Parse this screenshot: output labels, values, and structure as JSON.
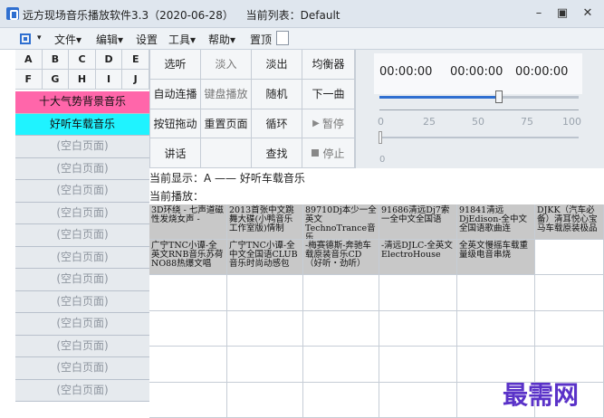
{
  "window": {
    "title": "远方现场音乐播放软件3.3（2020-06-28）",
    "current_list_label": "当前列表：Default",
    "minimize_glyph": "–",
    "maximize_glyph": "▣",
    "close_glyph": "✕"
  },
  "menubar": {
    "items": [
      "文件▾",
      "编辑▾",
      "设置",
      "工具▾",
      "帮助▾",
      "置顶"
    ]
  },
  "letters": [
    "A",
    "B",
    "C",
    "D",
    "E",
    "F",
    "G",
    "H",
    "I",
    "J"
  ],
  "pages": [
    "十大气势背景音乐",
    "好听车载音乐",
    "(空白页面)",
    "(空白页面)",
    "(空白页面)",
    "(空白页面)",
    "(空白页面)",
    "(空白页面)",
    "(空白页面)",
    "(空白页面)",
    "(空白页面)",
    "(空白页面)",
    "(空白页面)",
    "(空白页面)"
  ],
  "function_buttons": [
    "选听",
    "淡入",
    "淡出",
    "均衡器",
    "自动连播",
    "键盘播放",
    "随机",
    "下一曲",
    "按钮拖动",
    "重置页面",
    "循环",
    "暂停",
    "讲话",
    "",
    "查找",
    "停止"
  ],
  "player": {
    "time_elapsed": "00:00:00",
    "time_remaining": "00:00:00",
    "time_total": "00:00:00",
    "volume_level_percent": 60,
    "ticks": [
      "0",
      "25",
      "50",
      "75",
      "100"
    ],
    "zero_label": "0"
  },
  "status": {
    "current_display": "当前显示：A —— 好听车载音乐",
    "current_playing": "当前播放："
  },
  "songs": [
    "3D环绕 - 七声道磁性发烧女声 -",
    "2013首张中文跳舞大碟(小鸭音乐工作室版)情制",
    "89710Dj本少一全英文TechnoTrance音乐",
    "91686清远Dj7索一全中文全国语",
    "91841清远DjEdison-全中文全国语歌曲连",
    "DJKK（汽车必备）清耳悦心宝马车载原装极品",
    "广宁TNC小谭-全英文RNB音乐苏荷NO88热爆文唱",
    "广宁TNC小谭-全中文全国语CLUB音乐时尚动感包",
    "-梅赛德斯-奔驰车载原装音乐CD（好听・劲听）",
    "-清远DJLC-全英文ElectroHouse",
    "全英文慢摇车载重量级电音串烧",
    ""
  ],
  "watermark": "最需网"
}
